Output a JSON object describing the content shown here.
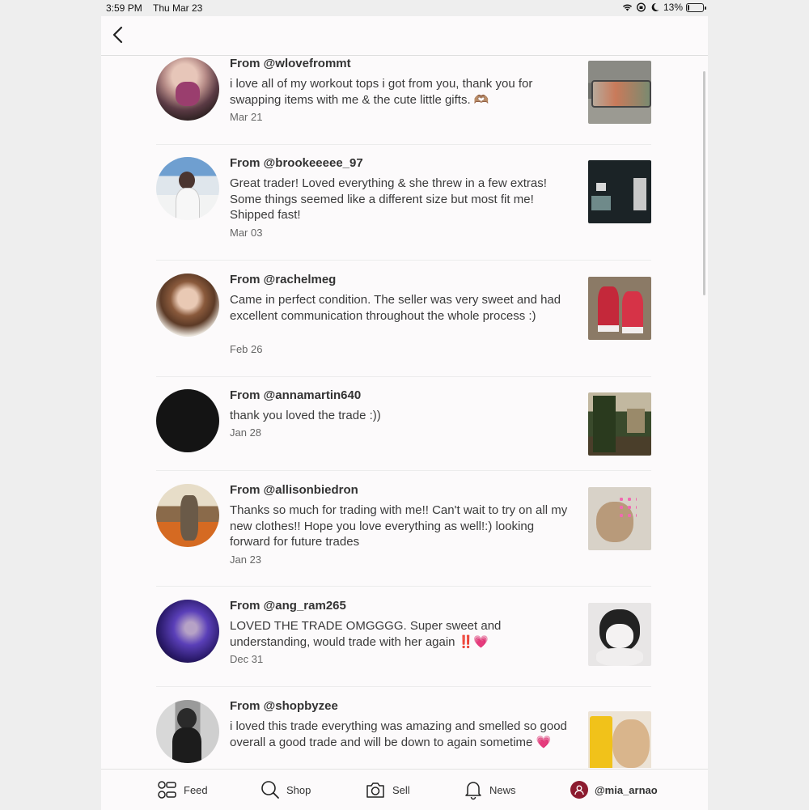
{
  "status": {
    "time": "3:59 PM",
    "date": "Thu Mar 23",
    "battery": "13%",
    "battery_level": 0.13,
    "icons": [
      "wifi-icon",
      "orientation-lock-icon",
      "moon-icon",
      "battery-icon"
    ]
  },
  "header": {
    "back_icon": "chevron-left-icon"
  },
  "reviews": [
    {
      "from": "From @wlovefrommt",
      "text": "i love all of my workout tops i got from you, thank you for swapping items with me & the cute little gifts. 🫶🏽",
      "date": "Mar 21"
    },
    {
      "from": "From @brookeeeee_97",
      "text": "Great trader! Loved everything & she threw in a few extras! Some things seemed like a different size but most fit me! Shipped fast!",
      "date": "Mar 03"
    },
    {
      "from": "From @rachelmeg",
      "text": "Came in perfect condition. The seller was very sweet and had excellent communication throughout the whole process :)",
      "date": "Feb 26"
    },
    {
      "from": "From @annamartin640",
      "text": "thank you loved the trade :))",
      "date": "Jan 28"
    },
    {
      "from": "From @allisonbiedron",
      "text": "Thanks so much for trading with me!! Can't wait to try on all my new clothes!! Hope you love everything as well!:) looking forward for future trades",
      "date": "Jan 23"
    },
    {
      "from": "From @ang_ram265",
      "text": "LOVED THE TRADE OMGGGG. Super sweet and understanding, would trade with her again ‼️💗",
      "date": "Dec 31"
    },
    {
      "from": "From @shopbyzee",
      "text": "i loved this trade everything was amazing and smelled so good overall a good trade and will be down to again sometime 💗",
      "date": ""
    }
  ],
  "tabs": [
    {
      "label": "Feed",
      "icon": "feed-icon"
    },
    {
      "label": "Shop",
      "icon": "search-icon"
    },
    {
      "label": "Sell",
      "icon": "camera-icon"
    },
    {
      "label": "News",
      "icon": "bell-icon"
    },
    {
      "label": "@mia_arnao",
      "icon": "profile-icon"
    }
  ],
  "colors": {
    "accent": "#8c1b2f",
    "background": "#fcfafb"
  }
}
